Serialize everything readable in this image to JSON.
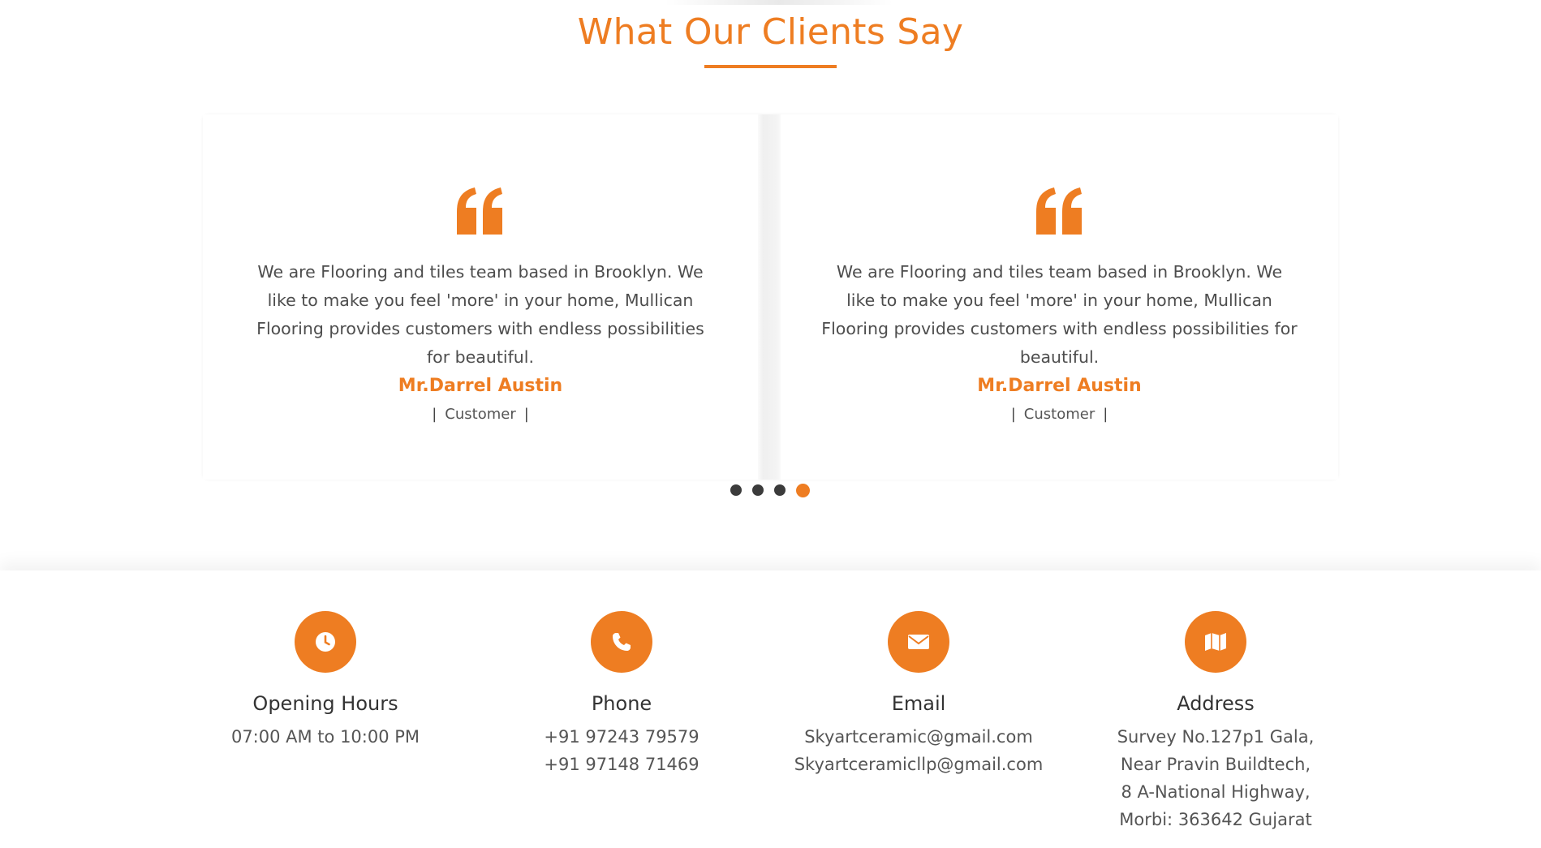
{
  "testimonials": {
    "title": "What Our Clients Say",
    "cards": [
      {
        "quote": "We are Flooring and tiles team based in Brooklyn. We like to make you feel 'more' in your home, Mullican Flooring provides customers with endless possibilities for beautiful.",
        "name": "Mr.Darrel Austin",
        "role": "Customer",
        "separator": "|"
      },
      {
        "quote": "We are Flooring and tiles team based in Brooklyn. We like to make you feel 'more' in your home, Mullican Flooring provides customers with endless possibilities for beautiful.",
        "name": "Mr.Darrel Austin",
        "role": "Customer",
        "separator": "|"
      }
    ],
    "pagination": {
      "total": 4,
      "active_index": 3
    }
  },
  "contact": {
    "items": [
      {
        "icon": "clock-icon",
        "title": "Opening Hours",
        "lines": [
          "07:00 AM to 10:00 PM"
        ]
      },
      {
        "icon": "phone-icon",
        "title": "Phone",
        "lines": [
          "+91 97243 79579",
          "+91 97148 71469"
        ]
      },
      {
        "icon": "envelope-icon",
        "title": "Email",
        "lines": [
          "Skyartceramic@gmail.com",
          "Skyartceramicllp@gmail.com"
        ]
      },
      {
        "icon": "map-icon",
        "title": "Address",
        "lines": [
          "Survey No.127p1 Gala,",
          "Near Pravin Buildtech,",
          "8 A-National Highway,",
          "Morbi: 363642 Gujarat"
        ]
      }
    ]
  },
  "colors": {
    "accent": "#ee7d22",
    "text": "#4d4d4d",
    "heading": "#333333",
    "dot_inactive": "#3b3b3b"
  }
}
